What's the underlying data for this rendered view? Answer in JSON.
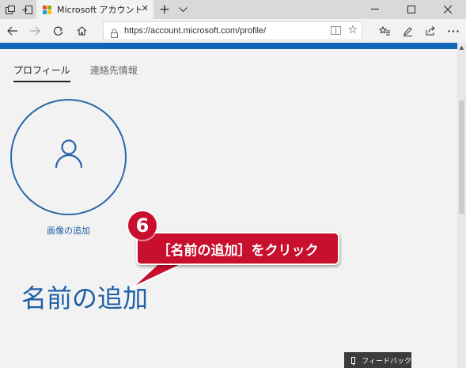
{
  "browser": {
    "tab_title": "Microsoft アカウント | 自分",
    "url": "https://account.microsoft.com/profile/",
    "accent": "#0f65b7"
  },
  "profile": {
    "tabs": [
      "プロフィール",
      "連絡先情報"
    ],
    "add_photo": "画像の追加",
    "add_name": "名前の追加"
  },
  "annotation": {
    "step": "6",
    "text": "［名前の追加］をクリック",
    "color": "#c8102e"
  },
  "feedback": {
    "label": "フィードバック"
  }
}
